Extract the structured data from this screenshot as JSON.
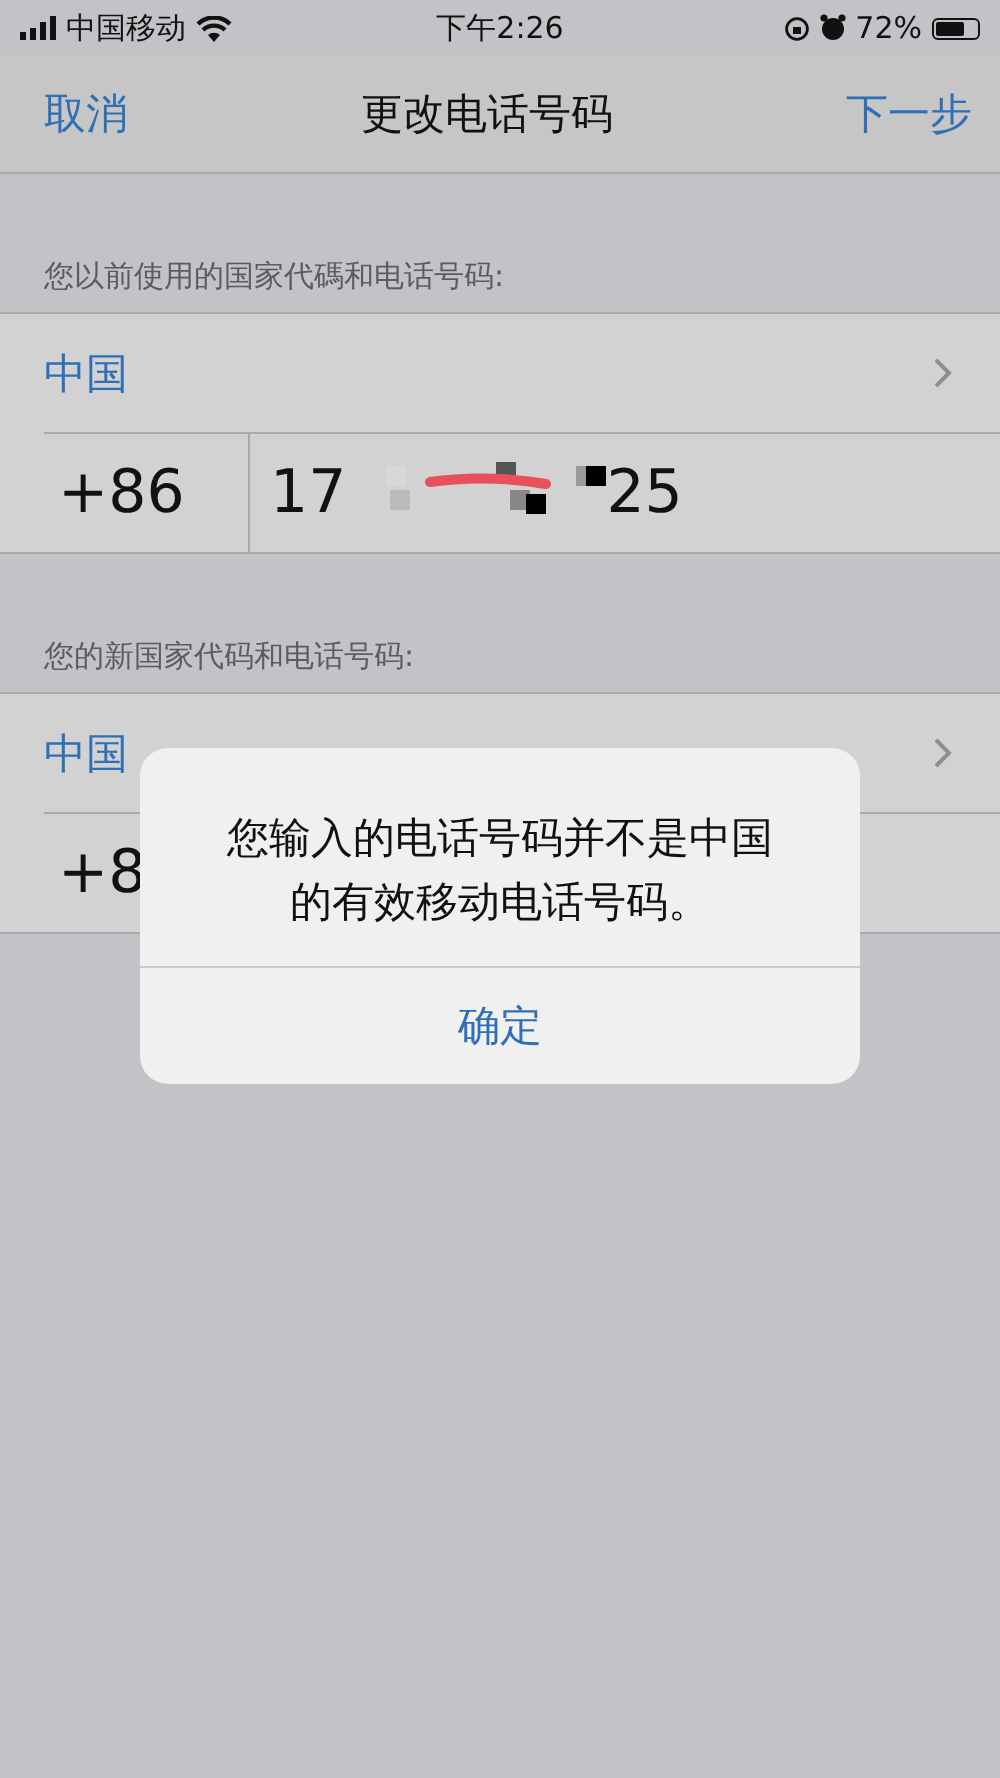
{
  "status_bar": {
    "carrier": "中国移动",
    "time": "下午2:26",
    "battery": "72%"
  },
  "nav": {
    "cancel": "取消",
    "title": "更改电话号码",
    "next": "下一步"
  },
  "sections": [
    {
      "header": "您以前使用的国家代碼和电话号码:",
      "country": "中国",
      "code": "+86",
      "number_start": "17",
      "number_end": "25",
      "redacted": true
    },
    {
      "header": "您的新国家代码和电话号码:",
      "country": "中国",
      "code": "+8"
    }
  ],
  "alert": {
    "message": "您输入的电话号码并不是中国的有效移动电话号码。",
    "button": "确定"
  }
}
